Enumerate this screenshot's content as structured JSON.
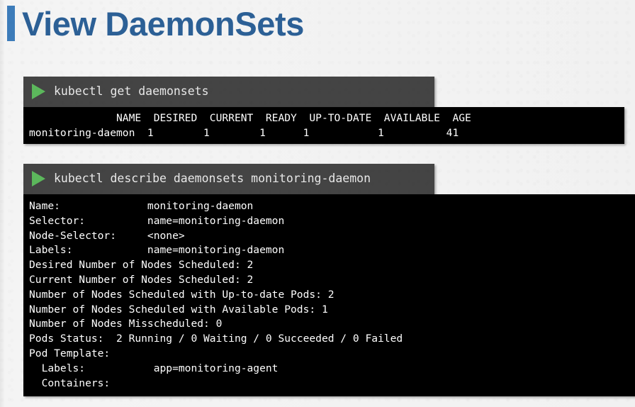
{
  "slide": {
    "title": "View DaemonSets",
    "accent_color": "#3d7cba",
    "title_color": "#2c6096",
    "background_color": "#f1f1f1"
  },
  "terminals": [
    {
      "name": "get-daemonsets",
      "prompt_icon": "play-icon",
      "command": "kubectl get daemonsets",
      "command_bg": "#444444",
      "output_bg": "#000000",
      "output": "              NAME  DESIRED  CURRENT  READY  UP-TO-DATE  AVAILABLE  AGE\nmonitoring-daemon  1        1        1      1           1          41",
      "table": {
        "columns": [
          "NAME",
          "DESIRED",
          "CURRENT",
          "READY",
          "UP-TO-DATE",
          "AVAILABLE",
          "AGE"
        ],
        "rows": [
          [
            "monitoring-daemon",
            "1",
            "1",
            "1",
            "1",
            "1",
            "41"
          ]
        ]
      }
    },
    {
      "name": "describe-daemonsets",
      "prompt_icon": "play-icon",
      "command": "kubectl describe daemonsets monitoring-daemon",
      "command_bg": "#444444",
      "output_bg": "#000000",
      "output": "Name:              monitoring-daemon\nSelector:          name=monitoring-daemon\nNode-Selector:     <none>\nLabels:            name=monitoring-daemon\nDesired Number of Nodes Scheduled: 2\nCurrent Number of Nodes Scheduled: 2\nNumber of Nodes Scheduled with Up-to-date Pods: 2\nNumber of Nodes Scheduled with Available Pods: 1\nNumber of Nodes Misscheduled: 0\nPods Status:  2 Running / 0 Waiting / 0 Succeeded / 0 Failed\nPod Template:\n  Labels:           app=monitoring-agent\n  Containers:",
      "fields": {
        "name": "monitoring-daemon",
        "selector": "name=monitoring-daemon",
        "node_selector": "<none>",
        "labels": "name=monitoring-daemon",
        "desired_number_of_nodes_scheduled": "2",
        "current_number_of_nodes_scheduled": "2",
        "nodes_scheduled_with_up_to_date_pods": "2",
        "nodes_scheduled_with_available_pods": "1",
        "nodes_misscheduled": "0",
        "pods_status": "2 Running / 0 Waiting / 0 Succeeded / 0 Failed",
        "pod_template_labels": "app=monitoring-agent"
      }
    }
  ]
}
